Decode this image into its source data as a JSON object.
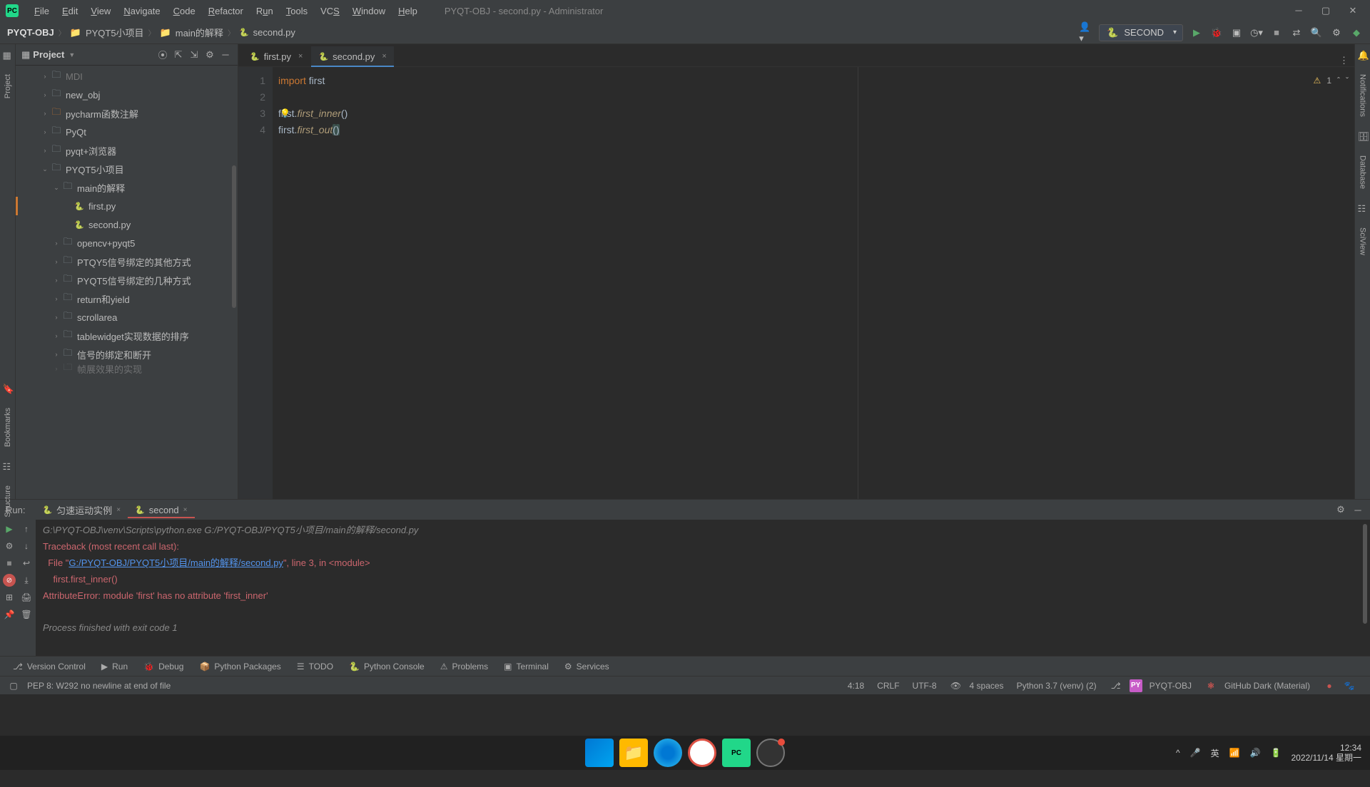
{
  "window": {
    "title": "PYQT-OBJ - second.py - Administrator"
  },
  "menus": [
    "File",
    "Edit",
    "View",
    "Navigate",
    "Code",
    "Refactor",
    "Run",
    "Tools",
    "VCS",
    "Window",
    "Help"
  ],
  "breadcrumb": {
    "project": "PYQT-OBJ",
    "items": [
      "PYQT5小项目",
      "main的解释",
      "second.py"
    ]
  },
  "runconfig": {
    "name": "SECOND"
  },
  "projectPanel": {
    "title": "Project"
  },
  "tree": [
    {
      "depth": 1,
      "arrow": "›",
      "icon": "folder",
      "label": "MDI",
      "dim": true
    },
    {
      "depth": 1,
      "arrow": "›",
      "icon": "folder",
      "label": "new_obj"
    },
    {
      "depth": 1,
      "arrow": "›",
      "icon": "folder-special",
      "label": "pycharm函数注解"
    },
    {
      "depth": 1,
      "arrow": "›",
      "icon": "folder",
      "label": "PyQt"
    },
    {
      "depth": 1,
      "arrow": "›",
      "icon": "folder",
      "label": "pyqt+浏览器"
    },
    {
      "depth": 1,
      "arrow": "⌄",
      "icon": "folder",
      "label": "PYQT5小项目"
    },
    {
      "depth": 2,
      "arrow": "⌄",
      "icon": "folder",
      "label": "main的解释"
    },
    {
      "depth": 3,
      "arrow": "",
      "icon": "py",
      "label": "first.py",
      "modified": true
    },
    {
      "depth": 3,
      "arrow": "",
      "icon": "py",
      "label": "second.py"
    },
    {
      "depth": 2,
      "arrow": "›",
      "icon": "folder",
      "label": "opencv+pyqt5"
    },
    {
      "depth": 2,
      "arrow": "›",
      "icon": "folder",
      "label": "PTQY5信号绑定的其他方式"
    },
    {
      "depth": 2,
      "arrow": "›",
      "icon": "folder",
      "label": "PYQT5信号绑定的几种方式"
    },
    {
      "depth": 2,
      "arrow": "›",
      "icon": "folder",
      "label": "return和yield"
    },
    {
      "depth": 2,
      "arrow": "›",
      "icon": "folder",
      "label": "scrollarea"
    },
    {
      "depth": 2,
      "arrow": "›",
      "icon": "folder",
      "label": "tablewidget实现数据的排序"
    },
    {
      "depth": 2,
      "arrow": "›",
      "icon": "folder",
      "label": "信号的绑定和断开"
    },
    {
      "depth": 2,
      "arrow": "›",
      "icon": "folder",
      "label": "帧展效果的实现",
      "cut": true
    }
  ],
  "editorTabs": [
    {
      "label": "first.py",
      "active": false
    },
    {
      "label": "second.py",
      "active": true
    }
  ],
  "editor": {
    "lines": [
      "1",
      "2",
      "3",
      "4"
    ],
    "l1": {
      "kw": "import",
      "id": " first"
    },
    "l3": {
      "a": "first.",
      "fn": "first_inner",
      "p": "()"
    },
    "l4": {
      "a": "first.",
      "fn": "first_out",
      "p1": "(",
      "p2": ")"
    },
    "warnings": "1"
  },
  "runTabs": [
    {
      "label": "匀速运动实例",
      "active": false
    },
    {
      "label": "second",
      "active": true
    }
  ],
  "runLabel": "Run:",
  "console": {
    "cmd": "G:\\PYQT-OBJ\\venv\\Scripts\\python.exe G:/PYQT-OBJ/PYQT5小项目/main的解释/second.py",
    "tb1": "Traceback (most recent call last):",
    "tb2a": "  File \"",
    "tb2link": "G:/PYQT-OBJ/PYQT5小项目/main的解释/second.py",
    "tb2b": "\", line 3, in <module>",
    "tb3": "    first.first_inner()",
    "tb4": "AttributeError: module 'first' has no attribute 'first_inner'",
    "exit": "Process finished with exit code 1"
  },
  "bottomTools": [
    {
      "icon": "⎇",
      "label": "Version Control"
    },
    {
      "icon": "▶",
      "label": "Run"
    },
    {
      "icon": "🐞",
      "label": "Debug"
    },
    {
      "icon": "📦",
      "label": "Python Packages"
    },
    {
      "icon": "☰",
      "label": "TODO"
    },
    {
      "icon": "🐍",
      "label": "Python Console"
    },
    {
      "icon": "⚠",
      "label": "Problems"
    },
    {
      "icon": "▣",
      "label": "Terminal"
    },
    {
      "icon": "⚙",
      "label": "Services"
    }
  ],
  "status": {
    "msg": "PEP 8: W292 no newline at end of file",
    "pos": "4:18",
    "sep": "CRLF",
    "enc": "UTF-8",
    "indent": "4 spaces",
    "interpreter": "Python 3.7 (venv) (2)",
    "project": "PYQT-OBJ",
    "theme": "GitHub Dark (Material)"
  },
  "leftGutter": {
    "project": "Project",
    "bookmarks": "Bookmarks",
    "structure": "Structure"
  },
  "rightGutter": {
    "notifications": "Notifications",
    "database": "Database",
    "sciview": "SciView"
  },
  "taskbar": {
    "ime": "英",
    "time": "12:34",
    "date": "2022/11/14 星期一"
  }
}
